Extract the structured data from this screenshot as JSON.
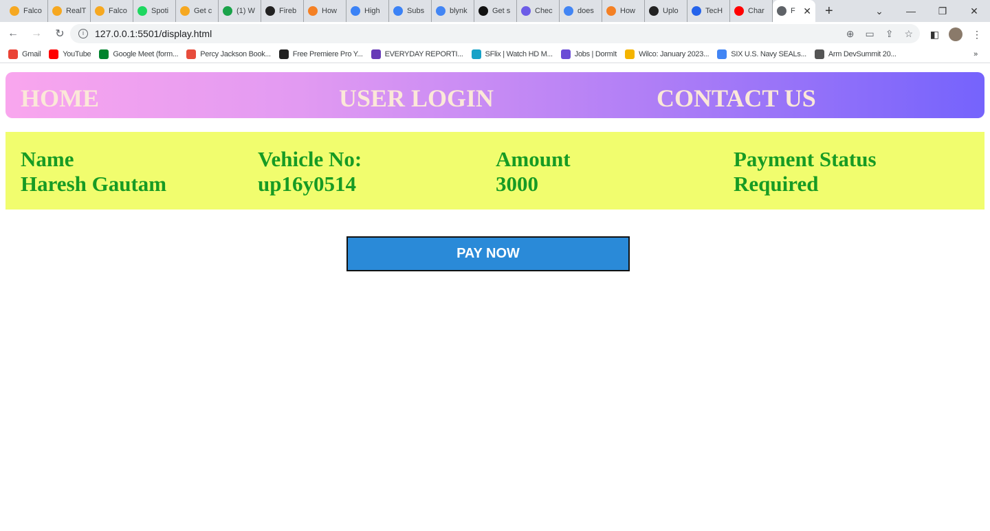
{
  "browser": {
    "tabs": [
      {
        "title": "Falco",
        "color": "#f6a821"
      },
      {
        "title": "RealT",
        "color": "#f6a821"
      },
      {
        "title": "Falco",
        "color": "#f6a821"
      },
      {
        "title": "Spoti",
        "color": "#1ed760"
      },
      {
        "title": "Get c",
        "color": "#f6a821"
      },
      {
        "title": "(1) W",
        "color": "#1aa34a"
      },
      {
        "title": "Fireb",
        "color": "#222"
      },
      {
        "title": "How",
        "color": "#f48024"
      },
      {
        "title": "High",
        "color": "#3b82f6"
      },
      {
        "title": "Subs",
        "color": "#3b82f6"
      },
      {
        "title": "blynk",
        "color": "#4285f4"
      },
      {
        "title": "Get s",
        "color": "#111"
      },
      {
        "title": "Chec",
        "color": "#6c5ce7"
      },
      {
        "title": "does",
        "color": "#4285f4"
      },
      {
        "title": "How",
        "color": "#f48024"
      },
      {
        "title": "Uplo",
        "color": "#222"
      },
      {
        "title": "TecH",
        "color": "#2563eb"
      },
      {
        "title": "Char",
        "color": "#ff0000"
      }
    ],
    "active_tab": {
      "title": "F",
      "close": "✕"
    },
    "new_tab": "+",
    "url": "127.0.0.1:5501/display.html",
    "bookmarks": [
      {
        "label": "Gmail",
        "color": "#ea4335"
      },
      {
        "label": "YouTube",
        "color": "#ff0000"
      },
      {
        "label": "Google Meet (form...",
        "color": "#00832d"
      },
      {
        "label": "Percy Jackson Book...",
        "color": "#e74c3c"
      },
      {
        "label": "Free Premiere Pro Y...",
        "color": "#222"
      },
      {
        "label": "EVERYDAY REPORTI...",
        "color": "#673ab7"
      },
      {
        "label": "SFlix | Watch HD M...",
        "color": "#17a2c8"
      },
      {
        "label": "Jobs | DormIt",
        "color": "#6a4bd6"
      },
      {
        "label": "Wilco: January 2023...",
        "color": "#f4b400"
      },
      {
        "label": "SIX U.S. Navy SEALs...",
        "color": "#4285f4"
      },
      {
        "label": "Arm DevSummit 20...",
        "color": "#555"
      }
    ],
    "bookmarks_more": "»"
  },
  "nav": {
    "home": "HOME",
    "login": "USER LOGIN",
    "contact": "CONTACT US"
  },
  "details": [
    {
      "label": "Name",
      "value": "Haresh Gautam"
    },
    {
      "label": "Vehicle No:",
      "value": "up16y0514"
    },
    {
      "label": "Amount",
      "value": "3000"
    },
    {
      "label": "Payment Status",
      "value": "Required"
    }
  ],
  "pay_button": "PAY NOW",
  "colors": {
    "info_bg": "#f1fd6e",
    "text_green": "#179b24",
    "button": "#2a8ad8",
    "nav_link": "#fbe8d8"
  }
}
